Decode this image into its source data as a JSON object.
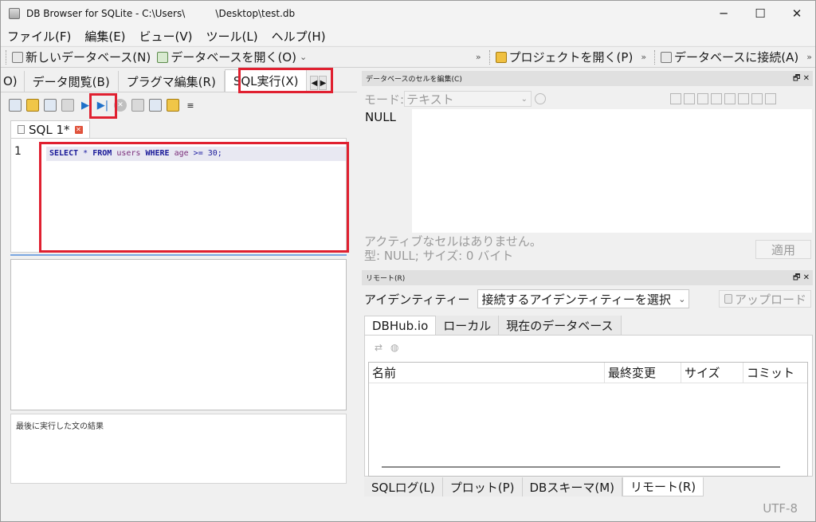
{
  "window": {
    "title": "DB Browser for SQLite - C:\\Users\\          \\Desktop\\test.db",
    "min_label": "─",
    "max_label": "☐",
    "close_label": "✕"
  },
  "menu": [
    "ファイル(F)",
    "編集(E)",
    "ビュー(V)",
    "ツール(L)",
    "ヘルプ(H)"
  ],
  "toolbar": {
    "new_db": "新しいデータベース(N)",
    "open_db": "データベースを開く(O)",
    "open_db_arrow": "⌄",
    "overflow1": "»",
    "open_project": "プロジェクトを開く(P)",
    "overflow2": "»",
    "connect_db": "データベースに接続(A)"
  },
  "left_tabs": {
    "clipped": "O)",
    "browse": "データ閲覧(B)",
    "pragma": "プラグマ編集(R)",
    "sql": "SQL実行(X)",
    "prev": "◀",
    "next": "▶"
  },
  "sql_tab": {
    "label": "SQL 1*",
    "close": "✕"
  },
  "editor": {
    "line_number": "1",
    "kw_select": "SELECT",
    "star": " * ",
    "kw_from": "FROM",
    "table": "users",
    "kw_where": "WHERE",
    "column": "age",
    "op": " >= ",
    "value": "30",
    "end": ";"
  },
  "last_result_label": "最後に実行した文の結果",
  "edit_cell": {
    "dock_title": "データベースのセルを編集(C)",
    "dock_btns": "🗗 ✕",
    "mode_label": "モード:",
    "mode_value": "テキスト",
    "mode_chev": "⌄",
    "null_label": "NULL",
    "info_line1": "アクティブなセルはありません。",
    "info_line2": "型: NULL; サイズ: 0 バイト",
    "apply": "適用"
  },
  "remote": {
    "dock_title": "リモート(R)",
    "dock_btns": "🗗 ✕",
    "identity_label": "アイデンティティー",
    "identity_value": "接続するアイデンティティーを選択",
    "identity_chev": "⌄",
    "upload": "アップロード",
    "tabs": [
      "DBHub.io",
      "ローカル",
      "現在のデータベース"
    ],
    "icons": [
      "⇄",
      "◍"
    ],
    "columns": [
      "名前",
      "最終変更",
      "サイズ",
      "コミット"
    ]
  },
  "bottom_tabs": [
    "SQLログ(L)",
    "プロット(P)",
    "DBスキーマ(M)",
    "リモート(R)"
  ],
  "status": {
    "encoding": "UTF-8"
  }
}
